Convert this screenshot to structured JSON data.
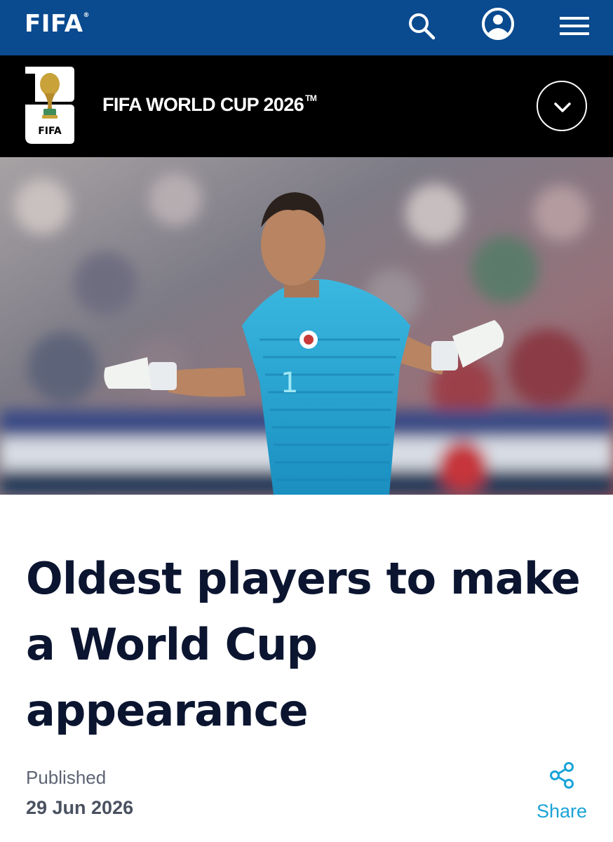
{
  "header": {
    "brand": "FIFA",
    "brand_mark": "®",
    "icons": [
      "search-icon",
      "user-icon",
      "menu-icon"
    ],
    "color": "#0a4a8f"
  },
  "tournament": {
    "logo_text": "FIFA",
    "title": "FIFA WORLD CUP 2026",
    "title_mark": "TM",
    "toggle_icon": "chevron-down-icon",
    "background": "#000000"
  },
  "hero": {
    "subject": "goalkeeper-photo",
    "shirt_number": "1"
  },
  "article": {
    "headline": "Oldest players to make a World Cup appearance",
    "published_label": "Published",
    "published_date": "29 Jun 2026",
    "share_label": "Share",
    "accent": "#1aa3d8"
  }
}
